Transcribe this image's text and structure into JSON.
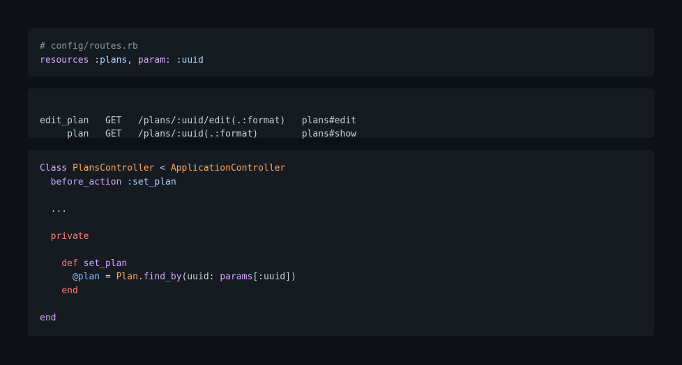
{
  "routes_block": {
    "comment": "# config/routes.rb",
    "method": "resources",
    "args_symbol": ":plans",
    "comma": ",",
    "param_key": "param:",
    "param_value": ":uuid"
  },
  "routes_output": {
    "rows": [
      {
        "name": "edit_plan",
        "verb": "GET",
        "path": "/plans/:uuid/edit(.:format)",
        "action": "plans#edit"
      },
      {
        "name": "plan",
        "verb": "GET",
        "path": "/plans/:uuid(.:format)",
        "action": "plans#show"
      }
    ]
  },
  "controller_block": {
    "class_kw": "Class",
    "class_name": "PlansController",
    "lt": "<",
    "parent": "ApplicationController",
    "before_action": "before_action",
    "before_action_sym": ":set_plan",
    "ellipsis": "...",
    "private_kw": "private",
    "def_kw": "def",
    "method_name": "set_plan",
    "ivar": "@plan",
    "eq": "=",
    "model": "Plan",
    "finder": "find_by",
    "open_paren": "(",
    "uuid_key": "uuid:",
    "params": "params",
    "params_index": "[:uuid]",
    "close_paren": ")",
    "end_inner": "end",
    "end_outer": "end"
  }
}
